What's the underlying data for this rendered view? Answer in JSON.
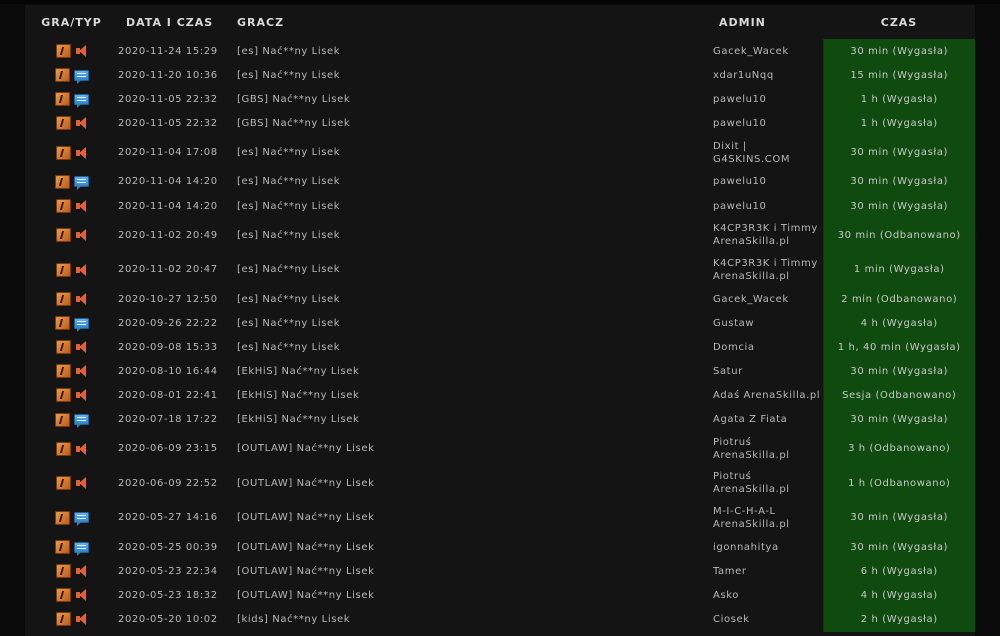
{
  "headers": {
    "game": "GRA/TYP",
    "date": "DATA I CZAS",
    "player": "GRACZ",
    "admin": "ADMIN",
    "time": "CZAS"
  },
  "icons": {
    "game": "counter-strike-icon",
    "voice": "speaker-icon",
    "chat": "chat-bubble-icon"
  },
  "rows": [
    {
      "type": "voice",
      "date": "2020-11-24 15:29",
      "player": "[es] Nać**ny Lisek",
      "admin": "Gacek_Wacek",
      "time": "30 min (Wygasła)"
    },
    {
      "type": "chat",
      "date": "2020-11-20 10:36",
      "player": "[es] Nać**ny Lisek",
      "admin": "xdar1uNqq",
      "time": "15 min (Wygasła)"
    },
    {
      "type": "chat",
      "date": "2020-11-05 22:32",
      "player": "[GBS] Nać**ny Lisek",
      "admin": "pawelu10",
      "time": "1 h (Wygasła)"
    },
    {
      "type": "voice",
      "date": "2020-11-05 22:32",
      "player": "[GBS] Nać**ny Lisek",
      "admin": "pawelu10",
      "time": "1 h (Wygasła)"
    },
    {
      "type": "voice",
      "date": "2020-11-04 17:08",
      "player": "[es] Nać**ny Lisek",
      "admin": "Dixit | G4SKINS.COM",
      "time": "30 min (Wygasła)"
    },
    {
      "type": "chat",
      "date": "2020-11-04 14:20",
      "player": "[es] Nać**ny Lisek",
      "admin": "pawelu10",
      "time": "30 min (Wygasła)"
    },
    {
      "type": "voice",
      "date": "2020-11-04 14:20",
      "player": "[es] Nać**ny Lisek",
      "admin": "pawelu10",
      "time": "30 min (Wygasła)"
    },
    {
      "type": "voice",
      "date": "2020-11-02 20:49",
      "player": "[es] Nać**ny Lisek",
      "admin": "K4CP3R3K i Timmy ArenaSkilla.pl",
      "time": "30 min (Odbanowano)"
    },
    {
      "type": "voice",
      "date": "2020-11-02 20:47",
      "player": "[es] Nać**ny Lisek",
      "admin": "K4CP3R3K i Timmy ArenaSkilla.pl",
      "time": "1 min (Wygasła)"
    },
    {
      "type": "voice",
      "date": "2020-10-27 12:50",
      "player": "[es] Nać**ny Lisek",
      "admin": "Gacek_Wacek",
      "time": "2 min (Odbanowano)"
    },
    {
      "type": "chat",
      "date": "2020-09-26 22:22",
      "player": "[es] Nać**ny Lisek",
      "admin": "Gustaw",
      "time": "4 h (Wygasła)"
    },
    {
      "type": "voice",
      "date": "2020-09-08 15:33",
      "player": "[es] Nać**ny Lisek",
      "admin": "Domcia",
      "time": "1 h, 40 min (Wygasła)"
    },
    {
      "type": "voice",
      "date": "2020-08-10 16:44",
      "player": "[EkHiS] Nać**ny Lisek",
      "admin": "Satur",
      "time": "30 min (Wygasła)"
    },
    {
      "type": "voice",
      "date": "2020-08-01 22:41",
      "player": "[EkHiS] Nać**ny Lisek",
      "admin": "Adaś ArenaSkilla.pl",
      "time": "Sesja (Odbanowano)"
    },
    {
      "type": "chat",
      "date": "2020-07-18 17:22",
      "player": "[EkHiS] Nać**ny Lisek",
      "admin": "Agata Z Fiata",
      "time": "30 min (Wygasła)"
    },
    {
      "type": "voice",
      "date": "2020-06-09 23:15",
      "player": "[OUTLAW] Nać**ny Lisek",
      "admin": "Piotruś ArenaSkilla.pl",
      "time": "3 h (Odbanowano)"
    },
    {
      "type": "voice",
      "date": "2020-06-09 22:52",
      "player": "[OUTLAW] Nać**ny Lisek",
      "admin": "Piotruś ArenaSkilla.pl",
      "time": "1 h (Odbanowano)"
    },
    {
      "type": "chat",
      "date": "2020-05-27 14:16",
      "player": "[OUTLAW] Nać**ny Lisek",
      "admin": "M-I-C-H-A-L ArenaSkilla.pl",
      "time": "30 min (Wygasła)"
    },
    {
      "type": "chat",
      "date": "2020-05-25 00:39",
      "player": "[OUTLAW] Nać**ny Lisek",
      "admin": "igonnahitya",
      "time": "30 min (Wygasła)"
    },
    {
      "type": "voice",
      "date": "2020-05-23 22:34",
      "player": "[OUTLAW] Nać**ny Lisek",
      "admin": "Tamer",
      "time": "6 h (Wygasła)"
    },
    {
      "type": "voice",
      "date": "2020-05-23 18:32",
      "player": "[OUTLAW] Nać**ny Lisek",
      "admin": "Asko",
      "time": "4 h (Wygasła)"
    },
    {
      "type": "voice",
      "date": "2020-05-20 10:02",
      "player": "[kids] Nać**ny Lisek",
      "admin": "Ciosek",
      "time": "2 h (Wygasła)"
    }
  ],
  "colors": {
    "time_cell": "#0f4a0f",
    "background": "#141414"
  }
}
